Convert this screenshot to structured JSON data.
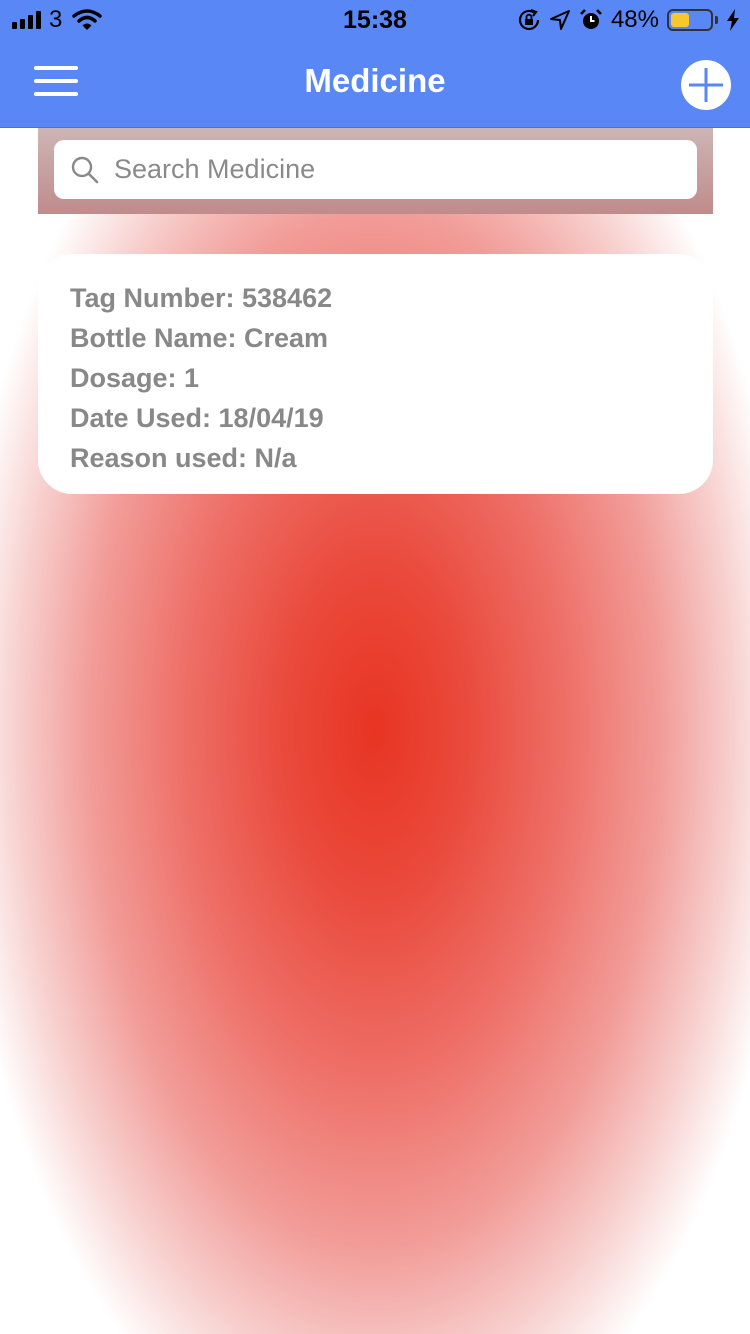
{
  "status_bar": {
    "carrier": "3",
    "time": "15:38",
    "battery_percent_text": "48%",
    "battery_level": 0.48,
    "battery_color": "#f5c82e"
  },
  "nav": {
    "title": "Medicine",
    "menu_icon": "hamburger-icon",
    "add_icon": "plus-icon",
    "bar_color": "#5987f6"
  },
  "search": {
    "placeholder": "Search Medicine",
    "value": "",
    "icon": "search-icon"
  },
  "medicines": [
    {
      "tag_line": "Tag Number: 538462",
      "bottle_line": "Bottle Name: Cream",
      "dosage_line": "Dosage: 1",
      "date_line": "Date Used: 18/04/19",
      "reason_line": "Reason used: N/a"
    }
  ]
}
